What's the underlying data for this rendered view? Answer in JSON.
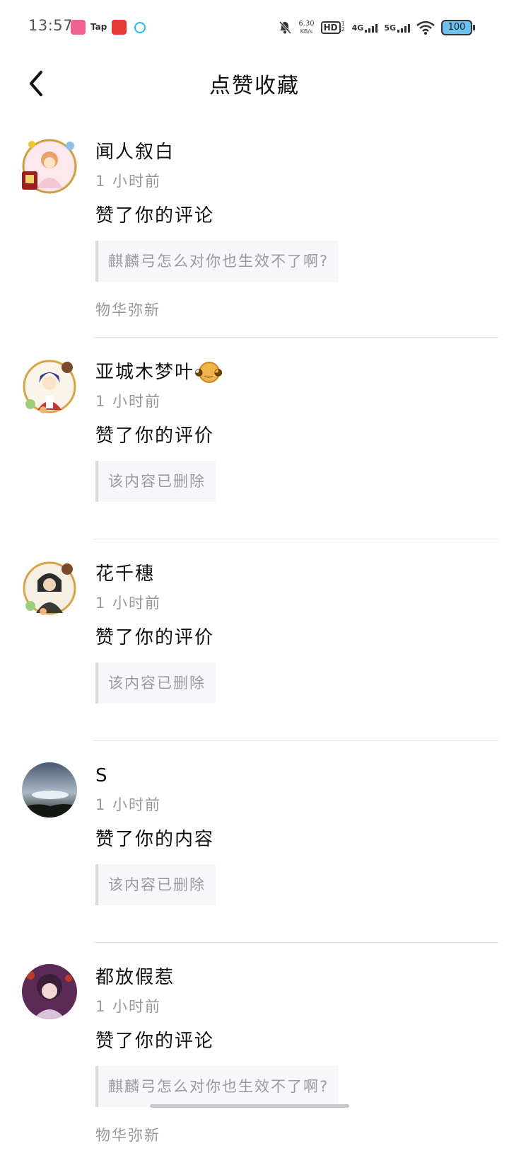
{
  "status_bar": {
    "time": "13:57",
    "apps": [
      "bilibili-icon",
      "tap-icon",
      "red-app-icon",
      "k-app-icon"
    ],
    "app_labels": {
      "tap": "Tap"
    },
    "net_speed_value": "6.30",
    "net_speed_unit": "KB/s",
    "hd": "HD",
    "hd_sub": "1 2",
    "net1": "4G",
    "net2": "5G",
    "battery": "100"
  },
  "header": {
    "title": "点赞收藏"
  },
  "feed": [
    {
      "name": "闻人叙白",
      "time": "1 小时前",
      "action": "赞了你的评论",
      "quote": "麒麟弓怎么对你也生效不了啊?",
      "source": "物华弥新",
      "avatar": "anime-girl-avatar"
    },
    {
      "name": "亚城木梦叶",
      "time": "1 小时前",
      "action": "赞了你的评价",
      "quote": "该内容已删除",
      "source": "",
      "avatar": "anime-boy-avatar",
      "badge": "orange-emoji-icon"
    },
    {
      "name": "花千穗",
      "time": "1 小时前",
      "action": "赞了你的评价",
      "quote": "该内容已删除",
      "source": "",
      "avatar": "anime-character-avatar"
    },
    {
      "name": "S",
      "time": "1 小时前",
      "action": "赞了你的内容",
      "quote": "该内容已删除",
      "source": "",
      "avatar": "sky-photo-avatar"
    },
    {
      "name": "都放假惹",
      "time": "1 小时前",
      "action": "赞了你的评论",
      "quote": "麒麟弓怎么对你也生效不了啊?",
      "source": "物华弥新",
      "avatar": "purple-anime-avatar"
    }
  ],
  "colors": {
    "text": "#111111",
    "secondary": "#999999",
    "quote_bg": "#f7f7fa",
    "quote_bar": "#d9d9de",
    "divider": "#e4e4e7"
  }
}
